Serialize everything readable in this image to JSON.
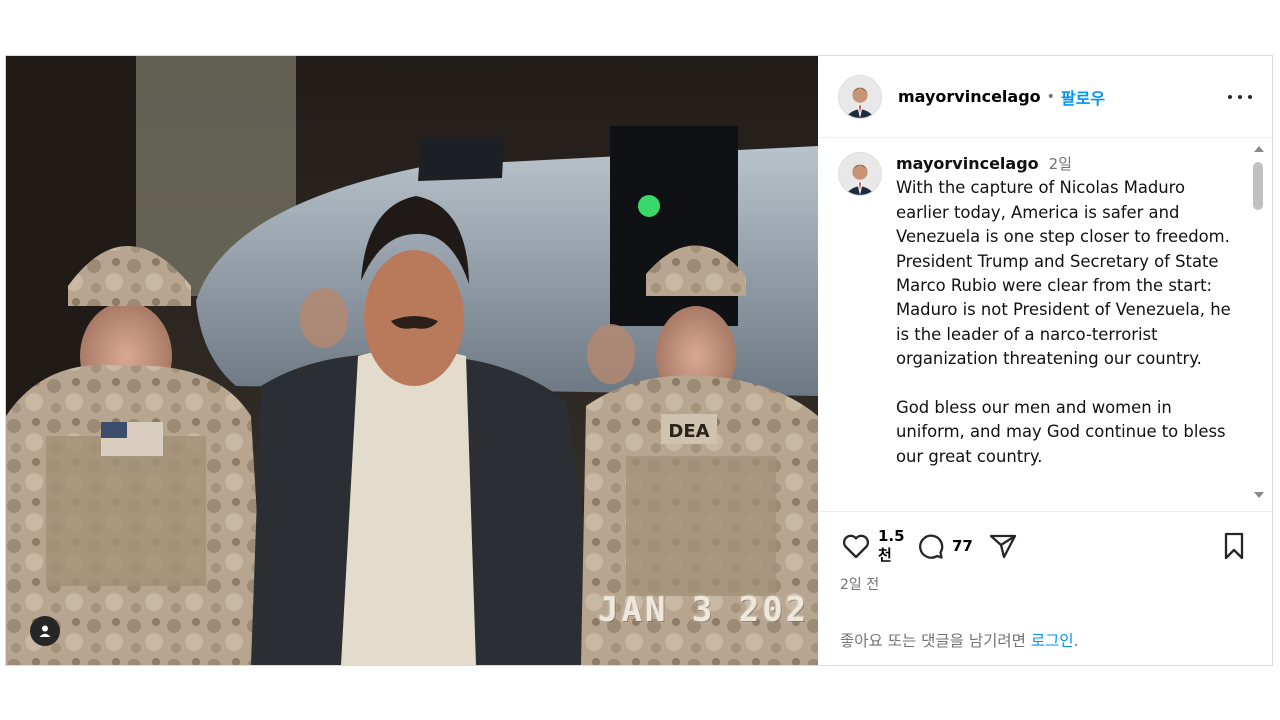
{
  "post": {
    "username": "mayorvincelago",
    "follow_label": "팔로우",
    "separator": "•",
    "time_ago": "2일",
    "caption_paragraphs": [
      "With the capture of Nicolas Maduro earlier today, America is safer and Venezuela is one step closer to freedom. President Trump and Secretary of State Marco Rubio were clear from the start: Maduro is not President of Venezuela, he is the leader of a narco-terrorist organization threatening our country.",
      "God bless our men and women in uniform, and may God continue to bless our great country."
    ],
    "like_count": "1.5 천",
    "comment_count": "77",
    "date_label": "2일 전",
    "login_prompt": "좋아요 또는 댓글을 남기려면",
    "login_link": "로그인",
    "login_period": "."
  },
  "photo": {
    "date_stamp": "JAN  3 202",
    "patch_text": "DEA"
  },
  "icons": {
    "more": "more-options-icon",
    "like": "heart-icon",
    "comment": "comment-icon",
    "share": "share-icon",
    "save": "bookmark-icon",
    "tag": "user-tag-icon"
  },
  "colors": {
    "link": "#0095f6",
    "secondary_text": "#737373",
    "border": "#dbdbdb"
  }
}
